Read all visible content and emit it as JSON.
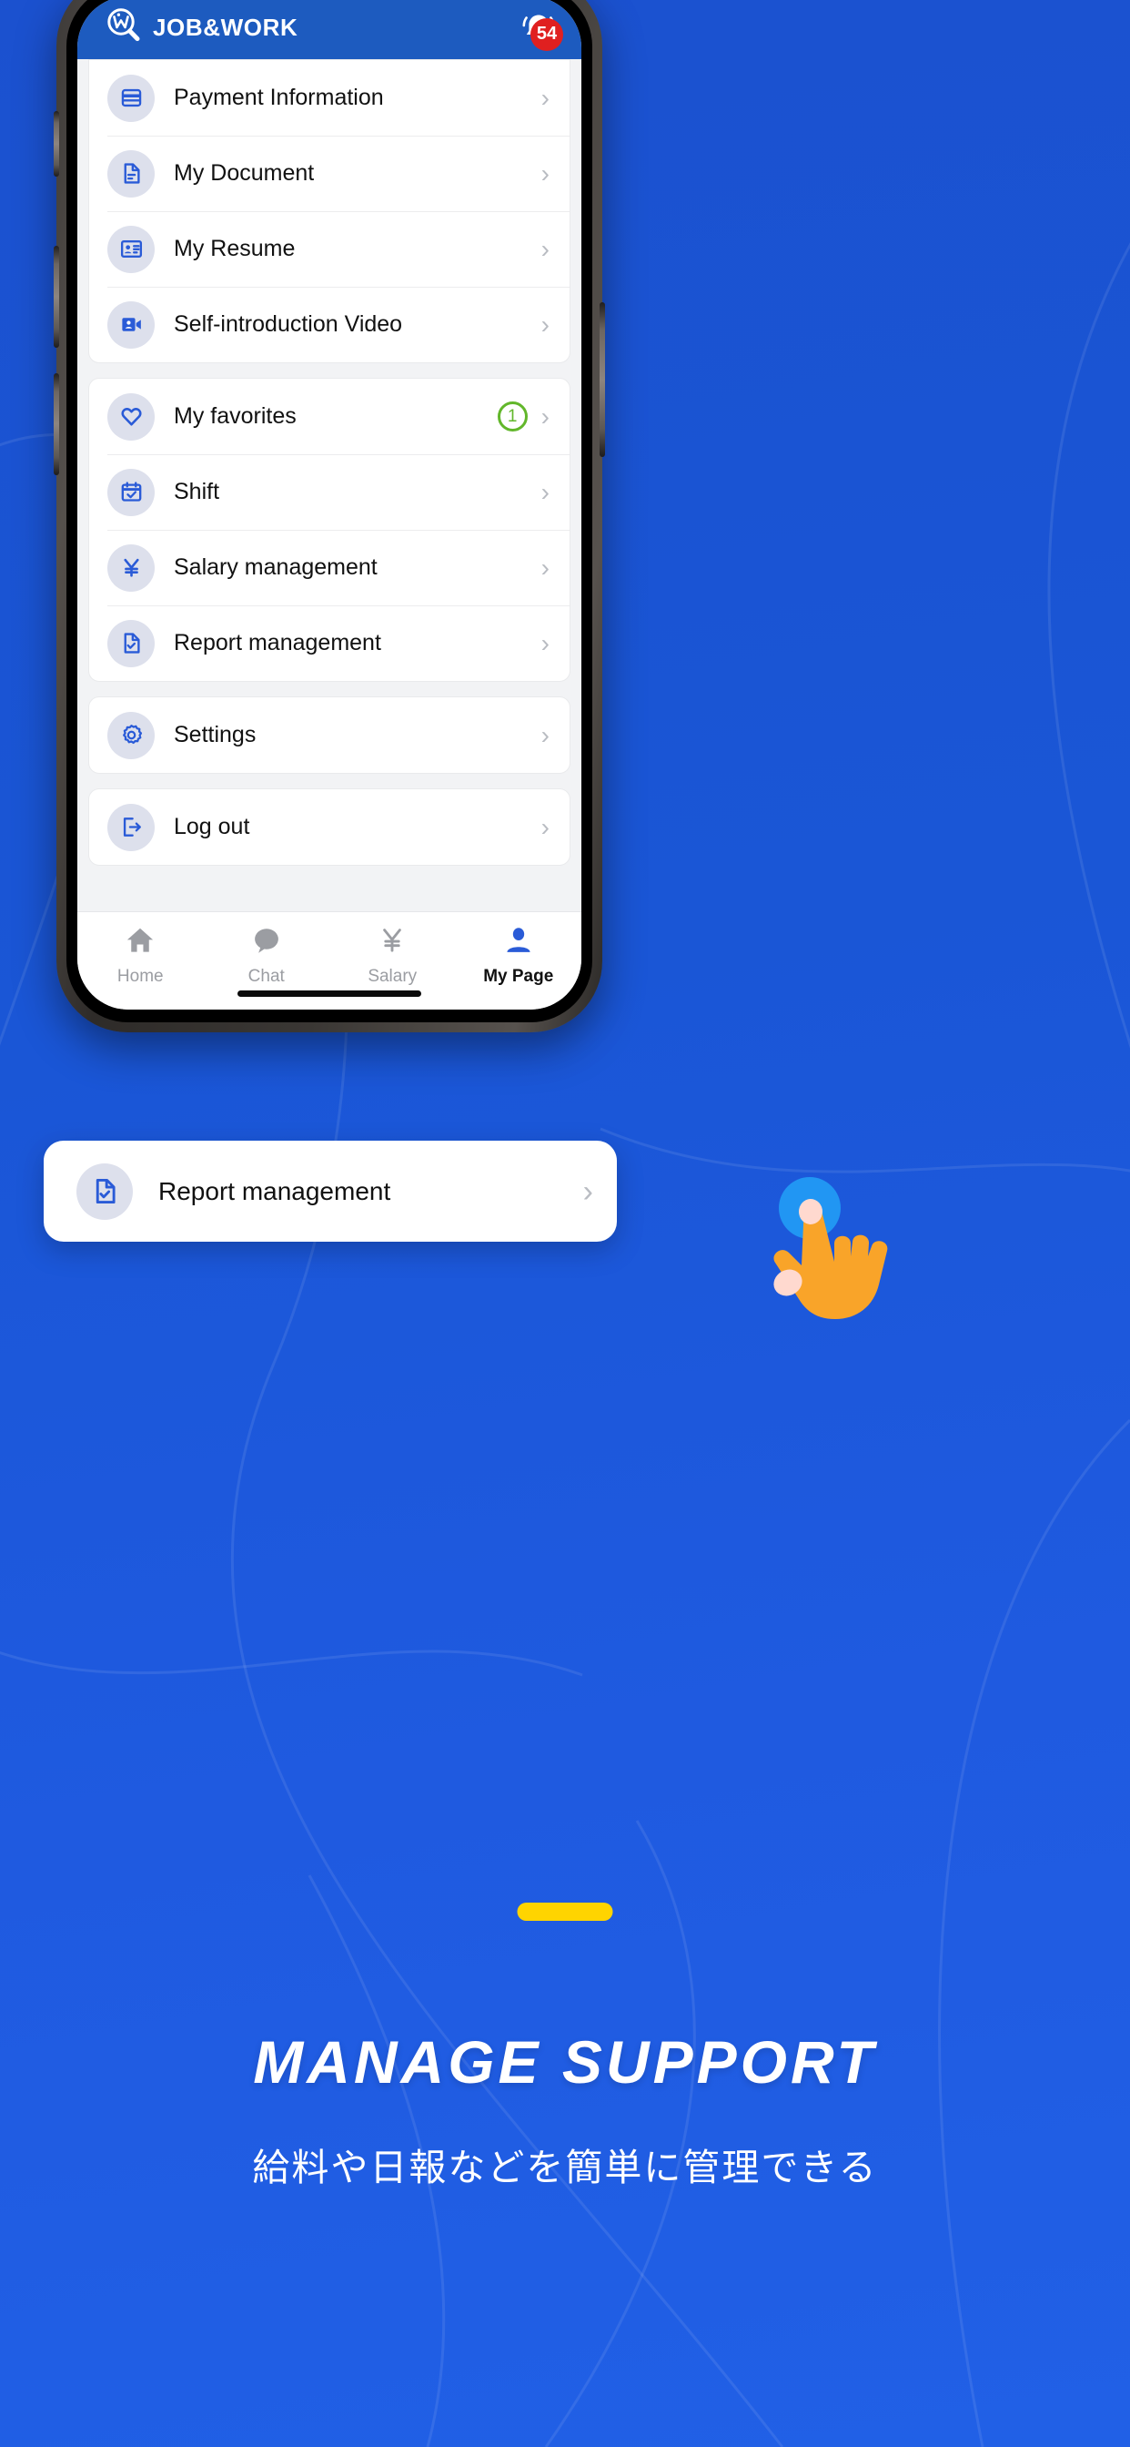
{
  "app": {
    "brand_name": "JOB&WORK",
    "logo_icon": "magnifier-jw-logo-icon",
    "bell_icon": "notification-bell-icon",
    "notification_count": "54",
    "header_bg": "#1d5bbf"
  },
  "menu": {
    "groups": [
      {
        "id": "account",
        "items": [
          {
            "label": "Payment Information",
            "icon": "credit-card-icon",
            "chevron": "›"
          },
          {
            "label": "My Document",
            "icon": "document-icon",
            "chevron": "›"
          },
          {
            "label": "My Resume",
            "icon": "id-card-icon",
            "chevron": "›"
          },
          {
            "label": "Self-introduction Video",
            "icon": "video-person-icon",
            "chevron": "›"
          }
        ]
      },
      {
        "id": "work",
        "items": [
          {
            "label": "My favorites",
            "icon": "heart-icon",
            "count": "1",
            "chevron": "›"
          },
          {
            "label": "Shift",
            "icon": "calendar-check-icon",
            "chevron": "›"
          },
          {
            "label": "Salary management",
            "icon": "yen-icon",
            "chevron": "›"
          },
          {
            "label": "Report management",
            "icon": "report-check-icon",
            "chevron": "›"
          }
        ]
      },
      {
        "id": "system",
        "items": [
          {
            "label": "Settings",
            "icon": "gear-icon",
            "chevron": "›"
          }
        ]
      },
      {
        "id": "session",
        "items": [
          {
            "label": "Log out",
            "icon": "logout-icon",
            "chevron": "›"
          }
        ]
      }
    ]
  },
  "callout": {
    "label": "Report management",
    "icon": "report-check-icon",
    "chevron": "›",
    "cursor_icon": "pointing-hand-cursor-icon",
    "tap_color": "#2196f3",
    "hand_color": "#f9a429"
  },
  "bottom_nav": {
    "items": [
      {
        "label": "Home",
        "icon": "home-icon",
        "active": false
      },
      {
        "label": "Chat",
        "icon": "chat-bubble-icon",
        "active": false
      },
      {
        "label": "Salary",
        "icon": "yen-icon",
        "active": false
      },
      {
        "label": "My Page",
        "icon": "person-icon",
        "active": true
      }
    ],
    "active_color": "#1d5bbf",
    "inactive_color": "#9b9da2"
  },
  "marketing": {
    "divider_color": "#ffd400",
    "headline": "MANAGE SUPPORT",
    "subhead": "給料や日報などを簡単に管理できる"
  },
  "theme": {
    "page_bg": "#1a56d6",
    "card_bg": "#ffffff",
    "icon_circle": "#dde0ec",
    "icon_blue": "#2a5bd7",
    "badge_red": "#e02020",
    "badge_green": "#62b72b"
  }
}
